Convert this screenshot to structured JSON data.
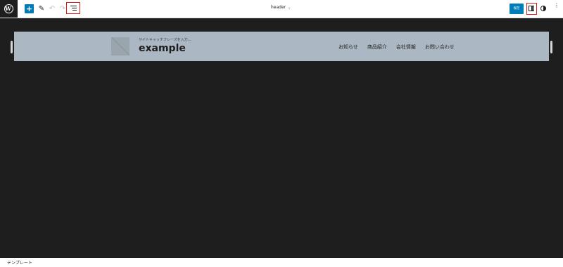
{
  "toolbar": {
    "add_symbol": "+",
    "pencil_symbol": "✎",
    "undo_symbol": "↶",
    "redo_symbol": "↷",
    "document_title": "header",
    "save_label": "保存",
    "more_symbol": "⋮",
    "icons": {
      "logo": "wordpress-logo-icon",
      "add": "plus-icon",
      "edit": "pencil-icon",
      "undo": "undo-icon",
      "redo": "redo-icon",
      "list_view": "list-view-icon",
      "settings": "sidebar-settings-icon",
      "styles": "half-circle-contrast-icon",
      "more": "vertical-ellipsis-icon"
    },
    "accent_color": "#007cba",
    "highlight_color": "#e01b1b"
  },
  "canvas": {
    "background": "#1e1e1e",
    "header_block": {
      "background": "#abb8c3",
      "tagline": "サイトキャッチフレーズを入力…",
      "site_title": "example",
      "nav_items": [
        "お知らせ",
        "商品紹介",
        "会社情報",
        "お問い合わせ"
      ]
    }
  },
  "footer": {
    "breadcrumb": "テンプレート"
  }
}
